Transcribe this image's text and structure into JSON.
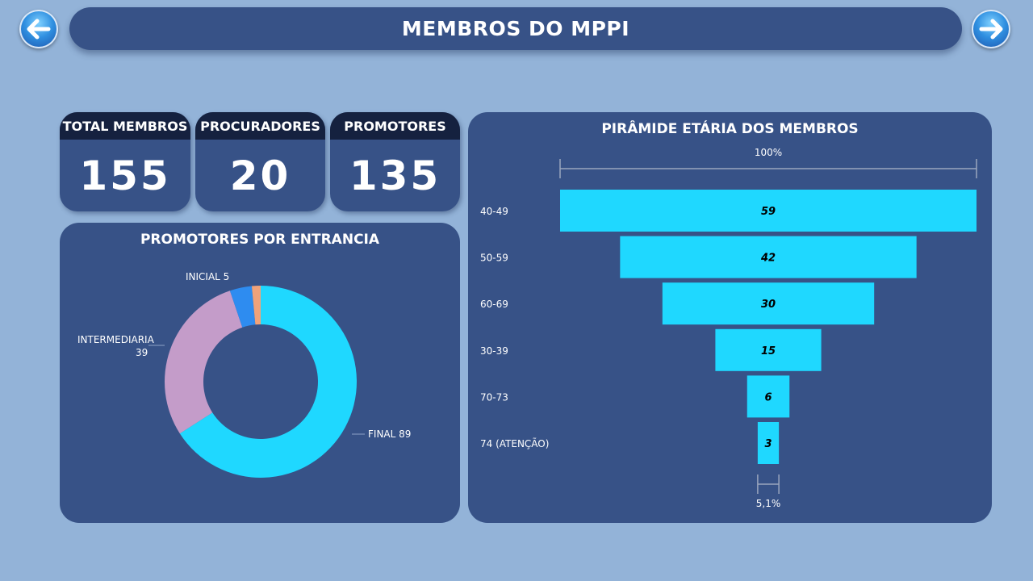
{
  "header": {
    "title": "MEMBROS DO MPPI"
  },
  "nav": {
    "back_icon": "arrow-left-icon",
    "forward_icon": "arrow-right-icon"
  },
  "kpis": [
    {
      "label": "TOTAL MEMBROS",
      "value": "155"
    },
    {
      "label": "PROCURADORES",
      "value": "20"
    },
    {
      "label": "PROMOTORES",
      "value": "135"
    }
  ],
  "colors": {
    "background": "#93b3d8",
    "panel": "#375287",
    "kpi_header": "#15213f",
    "bar": "#1fd8ff",
    "donut_final": "#1fd8ff",
    "donut_intermediaria": "#c49cc9",
    "donut_inicial": "#2e8cf0",
    "donut_other": "#f0a27a"
  },
  "chart_data": [
    {
      "type": "pie",
      "title": "PROMOTORES POR ENTRANCIA",
      "categories": [
        "FINAL",
        "INTERMEDIARIA",
        "INICIAL",
        ""
      ],
      "values": [
        89,
        39,
        5,
        2
      ],
      "labels": [
        "FINAL 89",
        "INTERMEDIARIA",
        "39",
        "INICIAL 5"
      ]
    },
    {
      "type": "bar",
      "title": "PIRÂMIDE ETÁRIA DOS MEMBROS",
      "categories": [
        "40-49",
        "50-59",
        "60-69",
        "30-39",
        "70-73",
        "74 (ATENÇÃO)"
      ],
      "values": [
        59,
        42,
        30,
        15,
        6,
        3
      ],
      "top_percent_label": "100%",
      "bottom_percent_label": "5,1%"
    }
  ]
}
